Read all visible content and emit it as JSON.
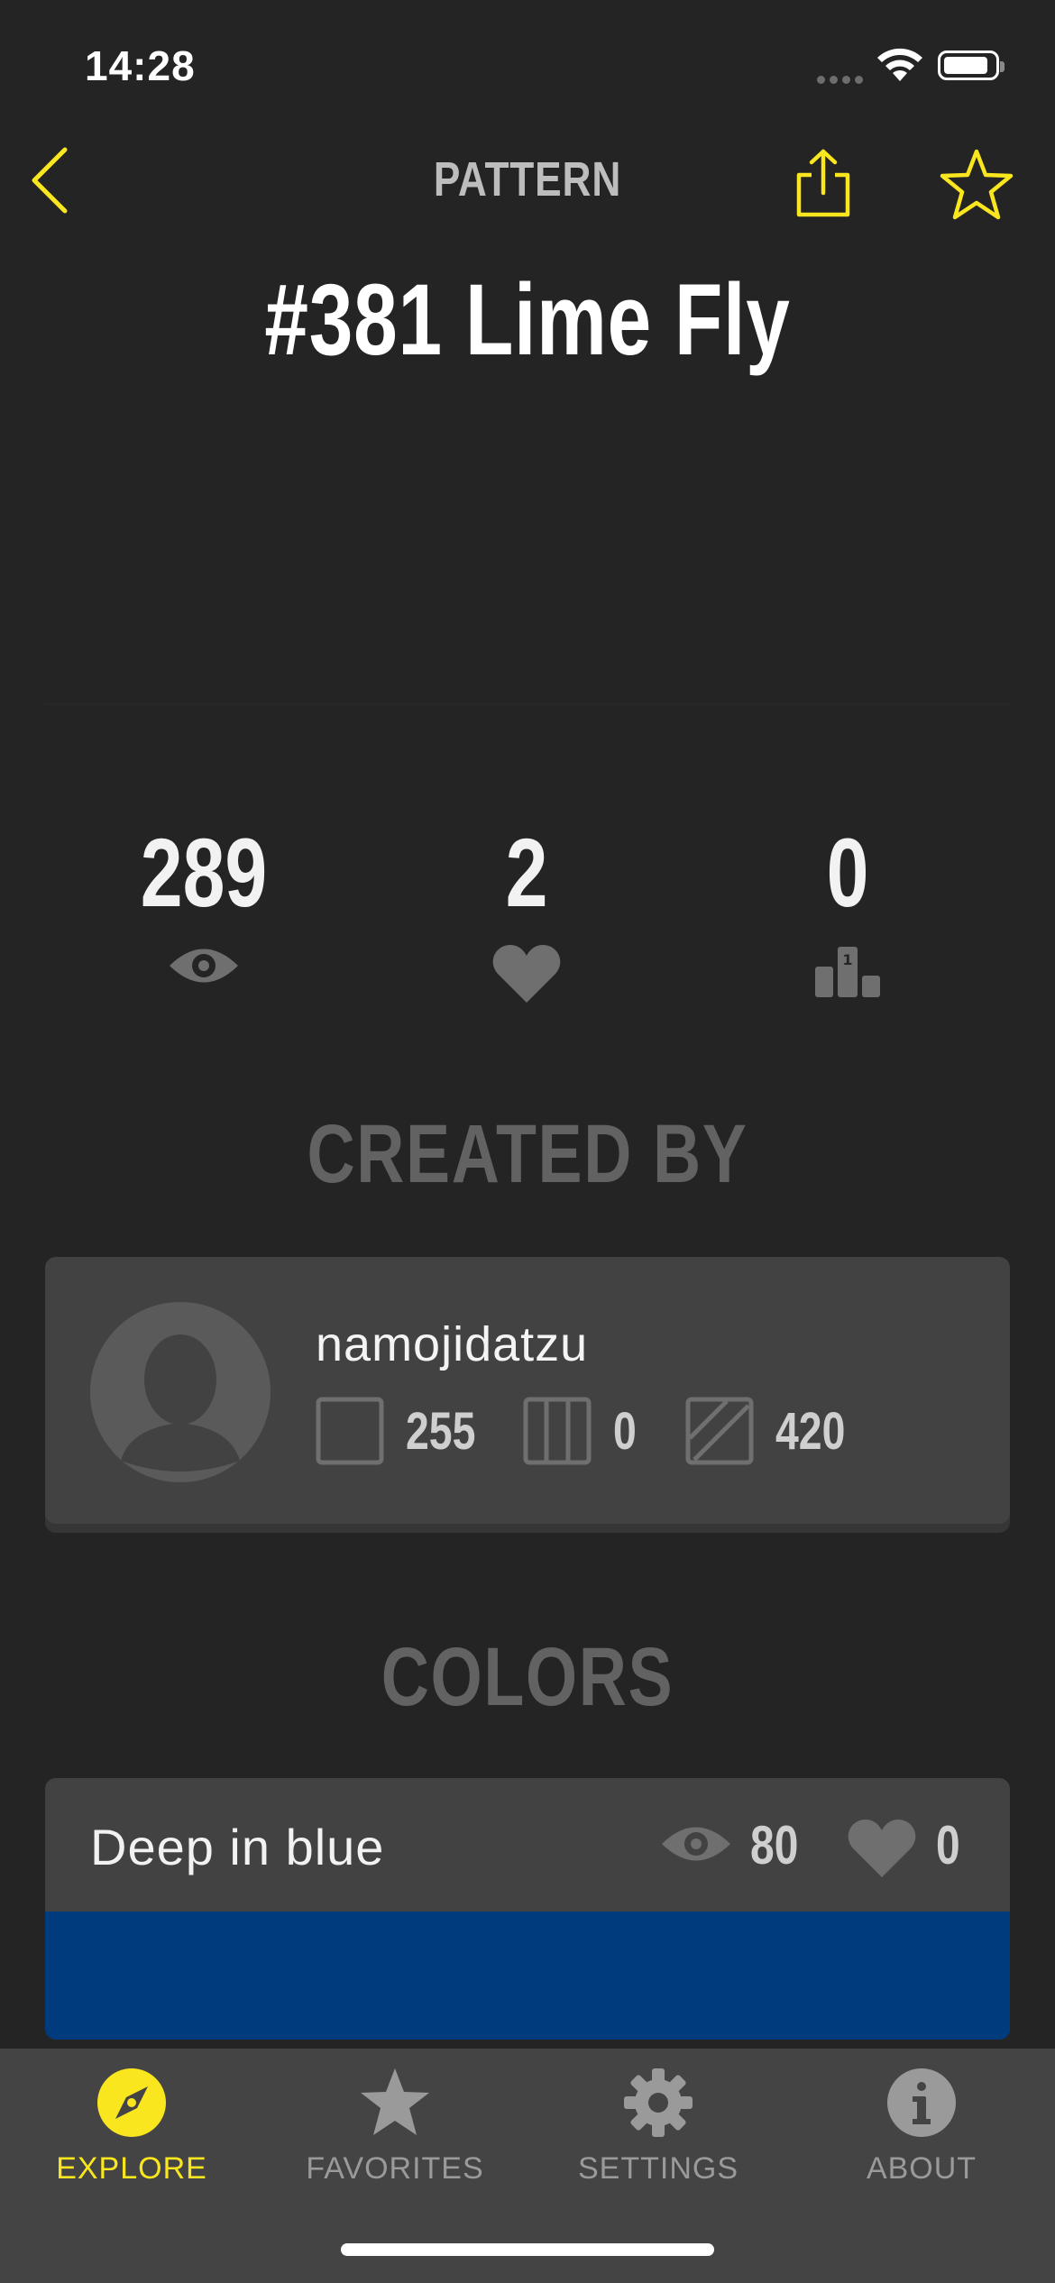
{
  "status_bar": {
    "time": "14:28"
  },
  "nav": {
    "title": "PATTERN"
  },
  "pattern": {
    "title": "#381 Lime Fly"
  },
  "stats": {
    "views": "289",
    "likes": "2",
    "rank": "0"
  },
  "created_by": {
    "heading": "CREATED BY",
    "username": "namojidatzu",
    "counts": {
      "squares": "255",
      "columns": "0",
      "stripes": "420"
    }
  },
  "colors": {
    "heading": "COLORS",
    "first": {
      "name": "Deep in blue",
      "views": "80",
      "likes": "0",
      "swatch": "#003b7e"
    }
  },
  "tabs": [
    {
      "label": "EXPLORE",
      "icon": "compass-icon",
      "active": true
    },
    {
      "label": "FAVORITES",
      "icon": "star-icon",
      "active": false
    },
    {
      "label": "SETTINGS",
      "icon": "gear-icon",
      "active": false
    },
    {
      "label": "ABOUT",
      "icon": "info-icon",
      "active": false
    }
  ],
  "theme": {
    "accent": "#f9e61f",
    "inactive": "#9a9a9a"
  }
}
